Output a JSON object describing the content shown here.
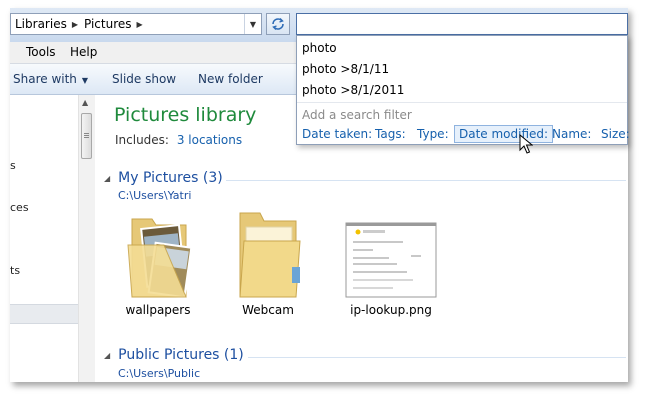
{
  "address_bar": {
    "crumbs": [
      "Libraries",
      "Pictures"
    ]
  },
  "menu": [
    "Tools",
    "Help"
  ],
  "commands": {
    "share": "Share with",
    "slideshow": "Slide show",
    "new_folder": "New folder"
  },
  "nav": {
    "items": [
      "s",
      "ces",
      "ts"
    ]
  },
  "library": {
    "title": "Pictures library",
    "includes_label": "Includes:",
    "includes_link": "3 locations"
  },
  "groups": [
    {
      "name": "My Pictures (3)",
      "path": "C:\\Users\\Yatri",
      "items": [
        {
          "label": "wallpapers",
          "icon": "folder-with-photos-icon"
        },
        {
          "label": "Webcam",
          "icon": "folder-icon"
        },
        {
          "label": "ip-lookup.png",
          "icon": "image-thumbnail-icon"
        }
      ]
    },
    {
      "name": "Public Pictures (1)",
      "path": "C:\\Users\\Public"
    }
  ],
  "search": {
    "value": "",
    "suggestions": [
      "photo",
      "photo >8/1/11",
      "photo >8/1/2011"
    ],
    "add_filter": "Add a search filter",
    "filters": [
      "Date taken:",
      "Tags:",
      "Type:",
      "Date modified:",
      "Name:",
      "Size:"
    ],
    "selected_filter": "Date modified:"
  },
  "colors": {
    "library_title": "#1f8a3c",
    "link": "#1660ad",
    "group_header": "#1d4fa0"
  }
}
